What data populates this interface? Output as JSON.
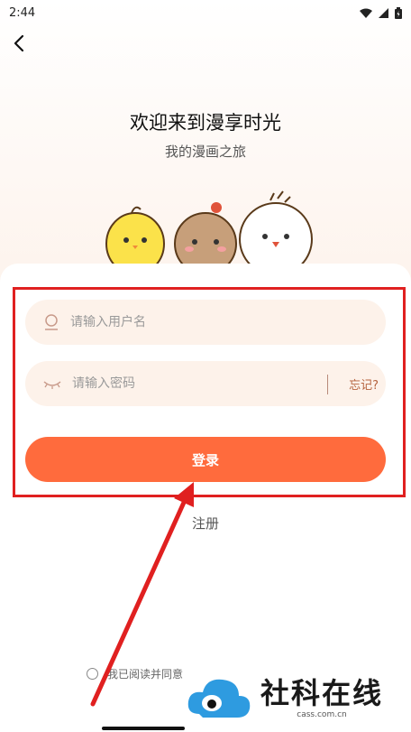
{
  "status_bar": {
    "time": "2:44"
  },
  "header": {
    "title": "欢迎来到漫享时光",
    "subtitle": "我的漫画之旅"
  },
  "form": {
    "username_placeholder": "请输入用户名",
    "password_placeholder": "请输入密码",
    "forgot_label": "忘记?",
    "login_label": "登录",
    "register_label": "注册",
    "agreement_text": "我已阅读并同意"
  },
  "watermark": {
    "brand": "社科在线",
    "domain": "cass.com.cn"
  },
  "colors": {
    "primary": "#ff6b3d",
    "input_bg": "#fdf2ea",
    "highlight": "#e02020"
  }
}
